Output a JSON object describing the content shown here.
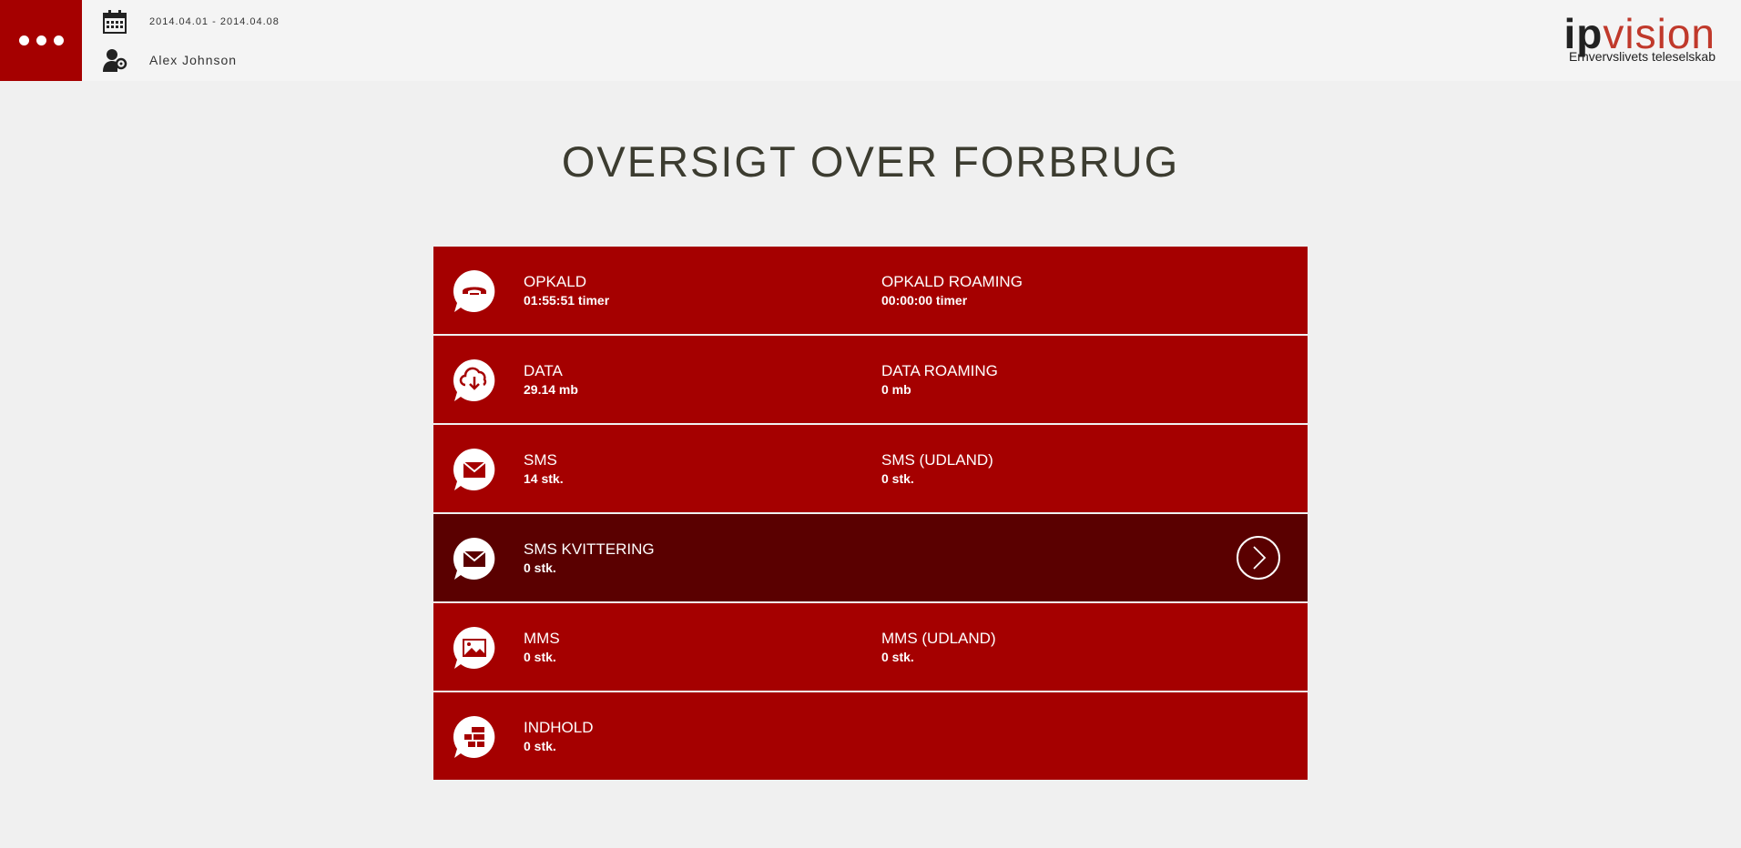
{
  "header": {
    "date_range": "2014.04.01 - 2014.04.08",
    "user_name": "Alex Johnson",
    "menu_icon": "ellipsis-icon",
    "calendar_icon": "calendar-icon",
    "user_icon": "user-settings-icon"
  },
  "logo": {
    "brand_ip": "ip",
    "brand_rest": "vision",
    "tagline": "Erhvervslivets teleselskab"
  },
  "page_title": "OVERSIGT OVER FORBRUG",
  "colors": {
    "accent": "#a50000",
    "selected_row": "#5a0000",
    "background": "#f0f0f0"
  },
  "rows": [
    {
      "icon": "phone-icon",
      "label": "OPKALD",
      "value": "01:55:51 timer",
      "label2": "OPKALD ROAMING",
      "value2": "00:00:00 timer"
    },
    {
      "icon": "cloud-download-icon",
      "label": "DATA",
      "value": "29.14 mb",
      "label2": "DATA ROAMING",
      "value2": "0 mb"
    },
    {
      "icon": "envelope-icon",
      "label": "SMS",
      "value": "14 stk.",
      "label2": "SMS (UDLAND)",
      "value2": "0 stk."
    },
    {
      "icon": "envelope-icon",
      "label": "SMS KVITTERING",
      "value": "0 stk.",
      "selected": true
    },
    {
      "icon": "image-icon",
      "label": "MMS",
      "value": "0 stk.",
      "label2": "MMS (UDLAND)",
      "value2": "0 stk."
    },
    {
      "icon": "blocks-icon",
      "label": "INDHOLD",
      "value": "0 stk."
    }
  ]
}
